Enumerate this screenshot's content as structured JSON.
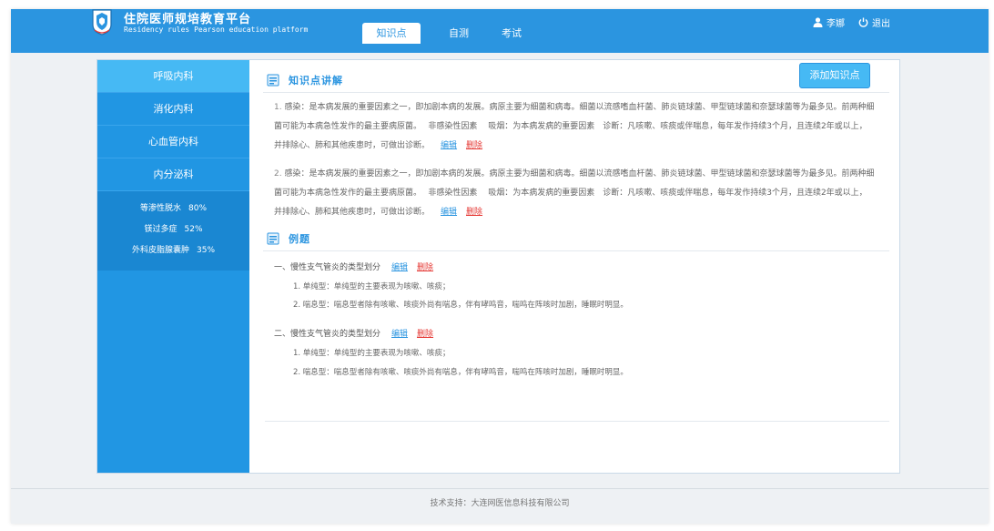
{
  "brand": {
    "title_cn": "住院医师规培教育平台",
    "title_en": "Residency rules Pearson education platform"
  },
  "tabs": [
    {
      "label": "知识点",
      "active": true
    },
    {
      "label": "自测",
      "active": false
    },
    {
      "label": "考试",
      "active": false
    }
  ],
  "user": {
    "name": "李娜",
    "logout_label": "退出"
  },
  "sidebar": {
    "items": [
      {
        "label": "呼吸内科",
        "active": true
      },
      {
        "label": "消化内科",
        "active": false
      },
      {
        "label": "心血管内科",
        "active": false
      },
      {
        "label": "内分泌科",
        "active": false
      }
    ],
    "sub_items": [
      {
        "label": "等渗性脱水",
        "pct": "80%"
      },
      {
        "label": "镁过多症",
        "pct": "52%"
      },
      {
        "label": "外科皮脂腺囊肿",
        "pct": "35%"
      }
    ]
  },
  "knowledge": {
    "section_title": "知识点讲解",
    "add_button": "添加知识点",
    "entries": [
      {
        "num": "1.",
        "text": "感染：是本病发展的重要因素之一，即加剧本病的发展。病原主要为细菌和病毒。细菌以流感嗜血杆菌、肺炎链球菌、甲型链球菌和奈瑟球菌等为最多见。前两种细菌可能为本病急性发作的最主要病原菌。　 非感染性因素　 吸烟：为本病发病的重要因素　诊断：凡咳嗽、咳痰或伴喘息，每年发作持续3个月，且连续2年或以上，并排除心、肺和其他疾患时，可做出诊断。",
        "edit": "编辑",
        "delete": "删除"
      },
      {
        "num": "2.",
        "text": "感染：是本病发展的重要因素之一，即加剧本病的发展。病原主要为细菌和病毒。细菌以流感嗜血杆菌、肺炎链球菌、甲型链球菌和奈瑟球菌等为最多见。前两种细菌可能为本病急性发作的最主要病原菌。　 非感染性因素　 吸烟：为本病发病的重要因素　诊断：凡咳嗽、咳痰或伴喘息，每年发作持续3个月，且连续2年或以上，并排除心、肺和其他疾患时，可做出诊断。",
        "edit": "编辑",
        "delete": "删除"
      }
    ]
  },
  "examples": {
    "section_title": "例题",
    "items": [
      {
        "title": "一、慢性支气管炎的类型划分",
        "edit": "编辑",
        "delete": "删除",
        "lines": [
          "1. 单纯型：单纯型的主要表现为咳嗽、咳痰；",
          "2. 喘息型：喘息型者除有咳嗽、咳痰外尚有喘息，伴有哮鸣音，喘鸣在阵咳时加剧，睡眠时明显。"
        ]
      },
      {
        "title": "二、慢性支气管炎的类型划分",
        "edit": "编辑",
        "delete": "删除",
        "lines": [
          "1. 单纯型：单纯型的主要表现为咳嗽、咳痰；",
          "2. 喘息型：喘息型者除有咳嗽、咳痰外尚有喘息，伴有哮鸣音，喘鸣在阵咳时加剧，睡眠时明显。"
        ]
      }
    ]
  },
  "footer": {
    "text": "技术支持：大连网医信息科技有限公司"
  },
  "colors": {
    "brand": "#2b95e0",
    "sidebar": "#2196e3",
    "active": "#46b9f4",
    "delete": "#e53935"
  }
}
